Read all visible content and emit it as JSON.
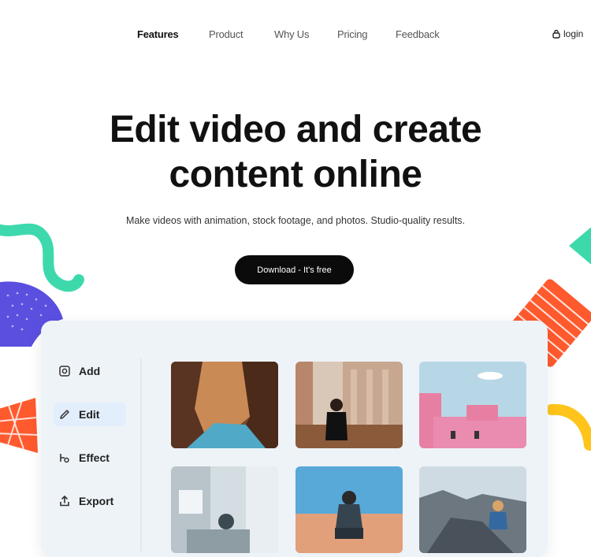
{
  "nav": {
    "items": [
      "Features",
      "Product",
      "Why Us",
      "Pricing",
      "Feedback"
    ],
    "login_label": "login"
  },
  "hero": {
    "title_line1": "Edit video and create",
    "title_line2": "content online",
    "subtitle": "Make videos with animation, stock footage, and photos. Studio-quality results.",
    "cta_label": "Download - It's free"
  },
  "app": {
    "sidebar": [
      {
        "label": "Add",
        "icon": "add-photo-icon"
      },
      {
        "label": "Edit",
        "icon": "pencil-icon"
      },
      {
        "label": "Effect",
        "icon": "effect-icon"
      },
      {
        "label": "Export",
        "icon": "export-icon"
      }
    ],
    "active_item": "Edit",
    "thumbnails": [
      {
        "subject": "canyon"
      },
      {
        "subject": "woman-sitting"
      },
      {
        "subject": "pink-building"
      },
      {
        "subject": "interior"
      },
      {
        "subject": "man-on-pier"
      },
      {
        "subject": "person-on-rocks"
      }
    ]
  },
  "colors": {
    "cta_bg": "#0b0b0b",
    "teal_shape": "#3dd9ad",
    "purple_shape": "#5b4fe0",
    "orange_shape": "#ff5a2e",
    "yellow_shape": "#ffc41a",
    "active_bg": "#e3eefc"
  }
}
